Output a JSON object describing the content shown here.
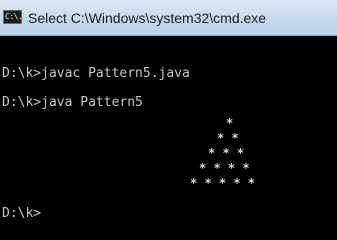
{
  "window": {
    "title": "Select C:\\Windows\\system32\\cmd.exe",
    "icon": "cmd-icon",
    "icon_glyph": "C:\\."
  },
  "console": {
    "lines": [
      "D:\\k>javac Pattern5.java",
      "D:\\k>java Pattern5",
      "D:\\k>"
    ],
    "pattern": [
      "*",
      "* *",
      "* * *",
      "* * * *",
      "* * * * *"
    ]
  }
}
